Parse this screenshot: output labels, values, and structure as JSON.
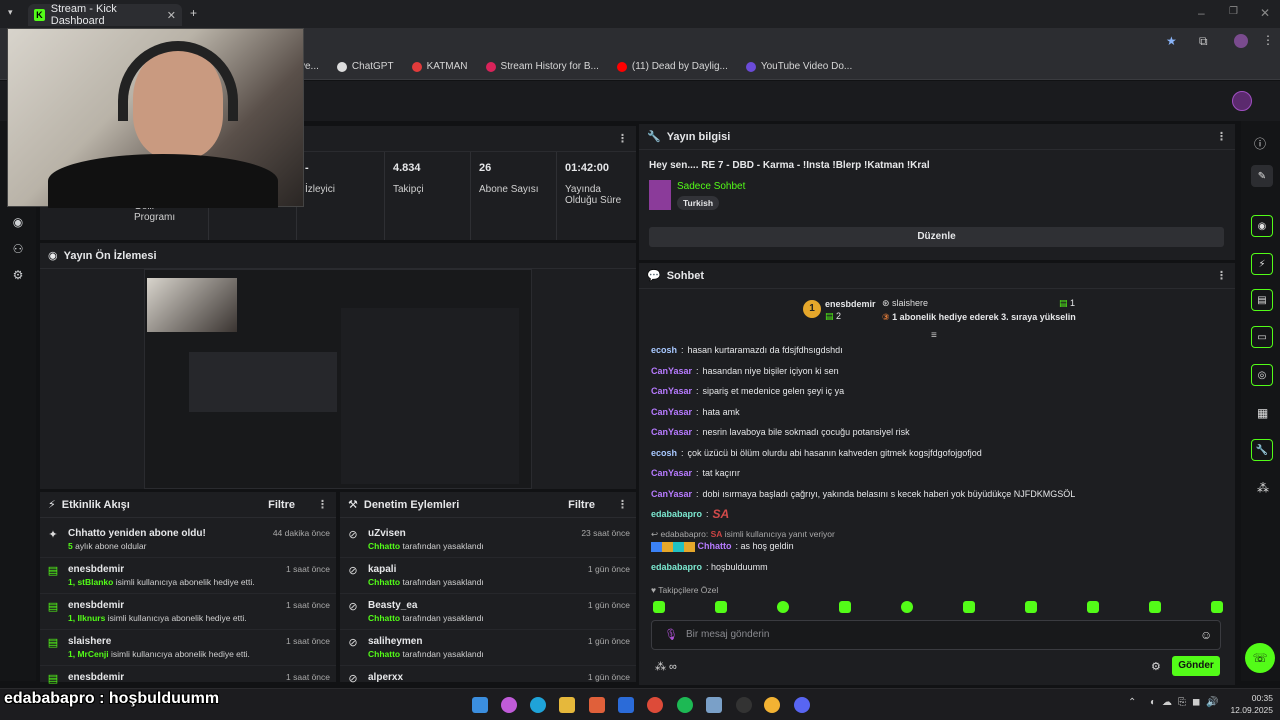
{
  "browser": {
    "tab_title": "Stream - Kick Dashboard",
    "bookmarks": [
      "ve...",
      "ChatGPT",
      "KATMAN",
      "Stream History for B...",
      "(11) Dead by Daylig...",
      "YouTube Video Do..."
    ]
  },
  "stats": [
    {
      "value": "-",
      "label": "İzleyici"
    },
    {
      "value": "4.834",
      "label": "Takipçi"
    },
    {
      "value": "26",
      "label": "Abone Sayısı"
    },
    {
      "value": "01:42:00",
      "label": "Yayında Olduğu Süre"
    }
  ],
  "stats_partial_label": "Gelir Programı",
  "stream_info": {
    "header": "Yayın bilgisi",
    "title": "Hey sen.... RE 7 - DBD - Karma - !Insta !Blerp !Katman !Kral",
    "category": "Sadece Sohbet",
    "tag": "Turkish",
    "edit_button": "Düzenle"
  },
  "preview": {
    "header": "Yayın Ön İzlemesi"
  },
  "activity": {
    "header": "Etkinlik Akışı",
    "filter": "Filtre",
    "items": [
      {
        "title": "Chhatto yeniden abone oldu!",
        "hl": "5",
        "rest": " aylık abone oldular",
        "time": "44 dakika önce"
      },
      {
        "title": "enesbdemir",
        "hl": "1, stBlanko",
        "rest": " isimli kullanıcıya abonelik hediye etti.",
        "time": "1 saat önce"
      },
      {
        "title": "enesbdemir",
        "hl": "1, Ilknurs",
        "rest": " isimli kullanıcıya abonelik hediye etti.",
        "time": "1 saat önce"
      },
      {
        "title": "slaishere",
        "hl": "1, MrCenji",
        "rest": " isimli kullanıcıya abonelik hediye etti.",
        "time": "1 saat önce"
      },
      {
        "title": "enesbdemir",
        "hl": "",
        "rest": "",
        "time": "1 saat önce"
      }
    ]
  },
  "moderation": {
    "header": "Denetim Eylemleri",
    "filter": "Filtre",
    "items": [
      {
        "title": "uZvisen",
        "hl": "Chhatto",
        "rest": " tarafından yasaklandı",
        "time": "23 saat önce"
      },
      {
        "title": "kapali",
        "hl": "Chhatto",
        "rest": " tarafından yasaklandı",
        "time": "1 gün önce"
      },
      {
        "title": "Beasty_ea",
        "hl": "Chhatto",
        "rest": " tarafından yasaklandı",
        "time": "1 gün önce"
      },
      {
        "title": "saliheymen",
        "hl": "Chhatto",
        "rest": " tarafından yasaklandı",
        "time": "1 gün önce"
      },
      {
        "title": "alperxx",
        "hl": "",
        "rest": "",
        "time": "1 gün önce"
      }
    ]
  },
  "chat": {
    "header": "Sohbet",
    "top_gifter": {
      "name": "enesbdemir",
      "count": "2",
      "rank": "1"
    },
    "second": {
      "name": "slaishere",
      "count": "1"
    },
    "pinned_message": "1 abonelik hediye ederek 3. sıraya yükselin",
    "messages": [
      {
        "user": "ecosh",
        "color": "#a8c8ff",
        "text": "hasan kurtaramazdı da fdsjfdhsıgdshdı"
      },
      {
        "user": "CanYasar",
        "color": "#b77bff",
        "text": "hasandan niye bişiler içiyon ki sen"
      },
      {
        "user": "CanYasar",
        "color": "#b77bff",
        "text": "sipariş et medenice gelen şeyi iç ya"
      },
      {
        "user": "CanYasar",
        "color": "#b77bff",
        "text": "hata amk"
      },
      {
        "user": "CanYasar",
        "color": "#b77bff",
        "text": "nesrin lavaboya bile sokmadı çocuğu potansiyel risk"
      },
      {
        "user": "ecosh",
        "color": "#a8c8ff",
        "text": "çok üzücü bi ölüm olurdu abi hasanın kahveden gitmek kogsjfdgofojgofjod"
      },
      {
        "user": "CanYasar",
        "color": "#b77bff",
        "text": "tat kaçırır"
      },
      {
        "user": "CanYasar",
        "color": "#b77bff",
        "text": "dobi ısırmaya başladı çağrıyı, yakında belasını s kecek haberi yok büyüdükçe NJFDKMGSÖL"
      },
      {
        "user": "edababapro",
        "color": "#7be8d0",
        "text": "SA"
      }
    ],
    "reply_context": {
      "user": "edababapro",
      "text": "isimli kullanıcıya yanıt veriyor"
    },
    "reply_message": {
      "user": "Chhatto",
      "text": "as hoş geldin"
    },
    "last_message": {
      "user": "edababapro",
      "text": "hoşbulduumm"
    },
    "emote_label": "Takipçilere Özel",
    "input_placeholder": "Bir mesaj gönderin",
    "send_button": "Gönder"
  },
  "overlay_caption": "edababapro : hoşbulduumm",
  "taskbar": {
    "time": "00:35",
    "date": "12.09.2025"
  },
  "colors": {
    "kick_green": "#53fc18",
    "panel": "#1d1e21",
    "background": "#111214"
  }
}
